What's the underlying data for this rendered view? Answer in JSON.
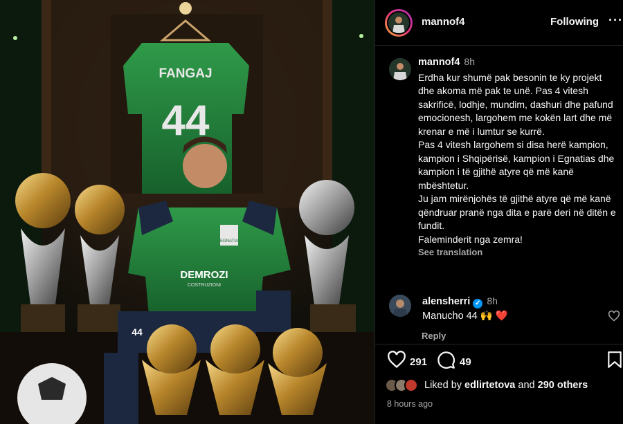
{
  "photo": {
    "jersey_name": "FANGAJ",
    "jersey_number": "44",
    "shirt_sponsor": "DEMROZI",
    "shirt_sponsor_sub": "COSTRUZIONI",
    "club_badge": "EGNATIA",
    "shorts_number": "44"
  },
  "header": {
    "username": "mannof4",
    "follow_label": "Following",
    "more_icon": "ellipsis-icon"
  },
  "caption": {
    "username": "mannof4",
    "time": "8h",
    "text": "Erdha kur shumë pak besonin te ky projekt dhe akoma më pak te unë. Pas 4 vitesh sakrificë, lodhje, mundim, dashuri dhe pafund emocionesh, largohem me kokën lart dhe më krenar e më i lumtur se kurrë.\nPas 4 vitesh largohem si disa herë kampion, kampion i Shqipërisë, kampion i Egnatias dhe kampion i të gjithë atyre që më kanë mbështetur.\nJu jam mirënjohës të gjithë atyre që më kanë qëndruar pranë nga dita e parë deri në ditën e fundit.\nFaleminderit nga zemra!",
    "see_translation": "See translation"
  },
  "comment": {
    "username": "alensherri",
    "verified": true,
    "time": "8h",
    "text": "Manucho 44 🙌 ❤️",
    "reply_label": "Reply"
  },
  "actions": {
    "like_count": "291",
    "comment_count": "49"
  },
  "likes": {
    "prefix": "Liked by",
    "user": "edlirtetova",
    "connector": "and",
    "others": "290 others"
  },
  "posted": "8 hours ago",
  "colors": {
    "background": "#000000",
    "text": "#f5f5f5",
    "muted": "#a8a8a8",
    "verified": "#0095f6",
    "heart": "#e0245e"
  }
}
